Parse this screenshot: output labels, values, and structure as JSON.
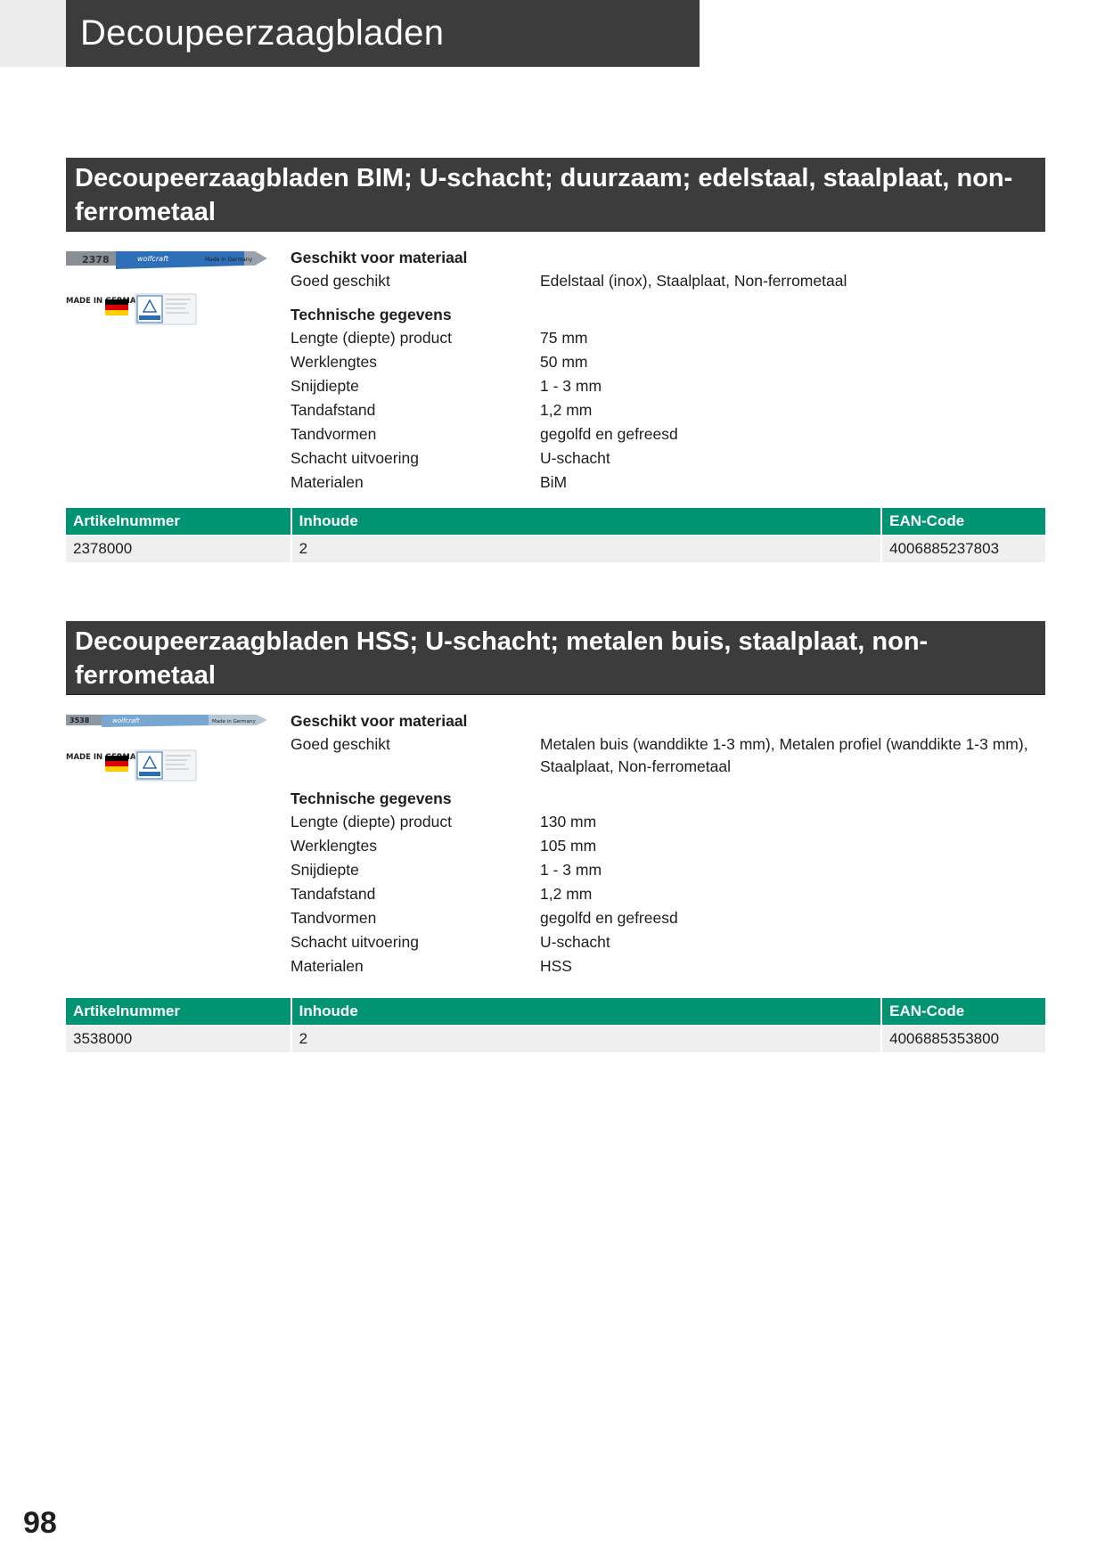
{
  "page": {
    "header_title": "Decoupeerzaagbladen",
    "page_number": "98"
  },
  "products": [
    {
      "title": "Decoupeerzaagbladen BIM; U-schacht; duurzaam; edelstaal, staalplaat, non-ferrometaal",
      "blade_code": "2378",
      "blade_brand": "wolfcraft",
      "blade_note": "Made in Germany",
      "badge_text": "MADE IN GERMANY",
      "material_heading": "Geschikt voor materiaal",
      "material_label": "Goed geschikt",
      "material_value": "Edelstaal (inox), Staalplaat, Non-ferrometaal",
      "tech_heading": "Technische gegevens",
      "specs": [
        {
          "label": "Lengte (diepte) product",
          "value": "75 mm"
        },
        {
          "label": "Werklengtes",
          "value": "50 mm"
        },
        {
          "label": "Snijdiepte",
          "value": "1 - 3 mm"
        },
        {
          "label": "Tandafstand",
          "value": "1,2 mm"
        },
        {
          "label": "Tandvormen",
          "value": "gegolfd en gefreesd"
        },
        {
          "label": "Schacht uitvoering",
          "value": "U-schacht"
        },
        {
          "label": "Materialen",
          "value": "BiM"
        }
      ],
      "table": {
        "headers": [
          "Artikelnummer",
          "Inhoude",
          "EAN-Code"
        ],
        "row": [
          "2378000",
          "2",
          "4006885237803"
        ]
      }
    },
    {
      "title": "Decoupeerzaagbladen HSS; U-schacht; metalen buis, staalplaat, non-ferrometaal",
      "blade_code": "3538",
      "blade_brand": "wolfcraft",
      "blade_note": "Made in Germany",
      "badge_text": "MADE IN GERMANY",
      "material_heading": "Geschikt voor materiaal",
      "material_label": "Goed geschikt",
      "material_value": "Metalen buis (wanddikte 1-3 mm), Metalen profiel (wanddikte 1-3 mm),",
      "material_value_2": "Staalplaat, Non-ferrometaal",
      "tech_heading": "Technische gegevens",
      "specs": [
        {
          "label": "Lengte (diepte) product",
          "value": "130 mm"
        },
        {
          "label": "Werklengtes",
          "value": "105 mm"
        },
        {
          "label": "Snijdiepte",
          "value": "1 - 3 mm"
        },
        {
          "label": "Tandafstand",
          "value": "1,2 mm"
        },
        {
          "label": "Tandvormen",
          "value": "gegolfd en gefreesd"
        },
        {
          "label": "Schacht uitvoering",
          "value": "U-schacht"
        },
        {
          "label": "Materialen",
          "value": "HSS"
        }
      ],
      "table": {
        "headers": [
          "Artikelnummer",
          "Inhoude",
          "EAN-Code"
        ],
        "row": [
          "3538000",
          "2",
          "4006885353800"
        ]
      }
    }
  ],
  "colors": {
    "header_bg": "#3c3c3c",
    "table_header_bg": "#009473",
    "table_row_bg": "#efefef"
  }
}
